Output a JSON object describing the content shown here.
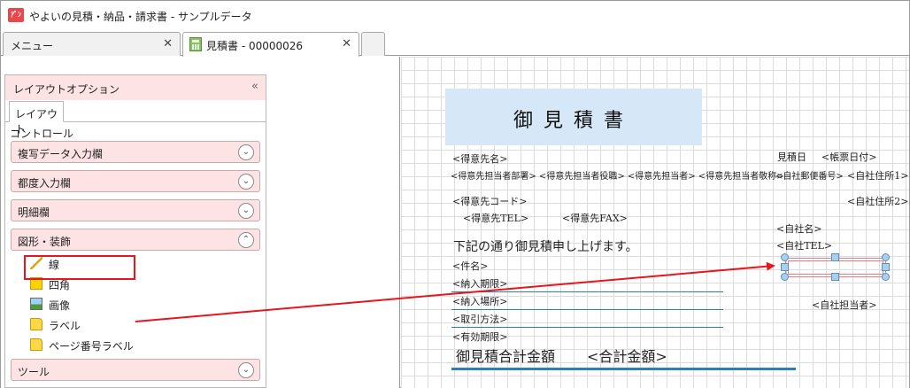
{
  "window": {
    "app_logo_text": "ｱﾟﾝ",
    "title": "やよいの見積・納品・請求書 - サンプルデータ"
  },
  "tabs": [
    {
      "label": "メニュー",
      "close": "✕"
    },
    {
      "label": "見積書 - 00000026",
      "close": "✕"
    }
  ],
  "panel": {
    "title": "レイアウトオプション",
    "collapse_icon": "«",
    "tab": "レイアウト",
    "controls_label": "コントロール",
    "sections": [
      {
        "label": "複写データ入力欄",
        "state": "collapsed"
      },
      {
        "label": "都度入力欄",
        "state": "collapsed"
      },
      {
        "label": "明細欄",
        "state": "collapsed"
      },
      {
        "label": "図形・装飾",
        "state": "expanded"
      },
      {
        "label": "ツール",
        "state": "collapsed"
      }
    ],
    "items": [
      {
        "label": "線",
        "icon": "line-icon"
      },
      {
        "label": "四角",
        "icon": "rectangle-icon"
      },
      {
        "label": "画像",
        "icon": "image-icon"
      },
      {
        "label": "ラベル",
        "icon": "label-icon"
      },
      {
        "label": "ページ番号ラベル",
        "icon": "label-icon"
      }
    ],
    "chevron_down": "⌄",
    "chevron_up": "⌃"
  },
  "document": {
    "title": "御見積書",
    "customer_name": "<得意先名>",
    "customer_contact_line": "<得意先担当者部署>  <得意先担当者役職>  <得意先担当者>  <得意先担当者敬称>",
    "customer_code": "<得意先コード>",
    "customer_tel": "<得意先TEL>",
    "customer_fax": "<得意先FAX>",
    "greeting": "下記の通り御見積申し上げます。",
    "subject": "<件名>",
    "delivery_deadline": "<納入期限>",
    "delivery_place": "<納入場所>",
    "payment_method": "<取引方法>",
    "valid_period": "<有効期限>",
    "total_label": "御見積合計金額",
    "total_value": "<合計金額>",
    "estimate_date_label": "見積日",
    "form_date": "<帳票日付>",
    "company_postal": "<自社郵便番号>",
    "company_address1": "<自社住所1>",
    "company_address2": "<自社住所2>",
    "company_name": "<自社名>",
    "company_tel": "<自社TEL>",
    "company_staff": "<自社担当者>"
  },
  "colors": {
    "accent": "#2a80b9",
    "panel_header": "#fde3e4",
    "highlight": "#e8161c",
    "title_box": "#d6e7f7"
  }
}
